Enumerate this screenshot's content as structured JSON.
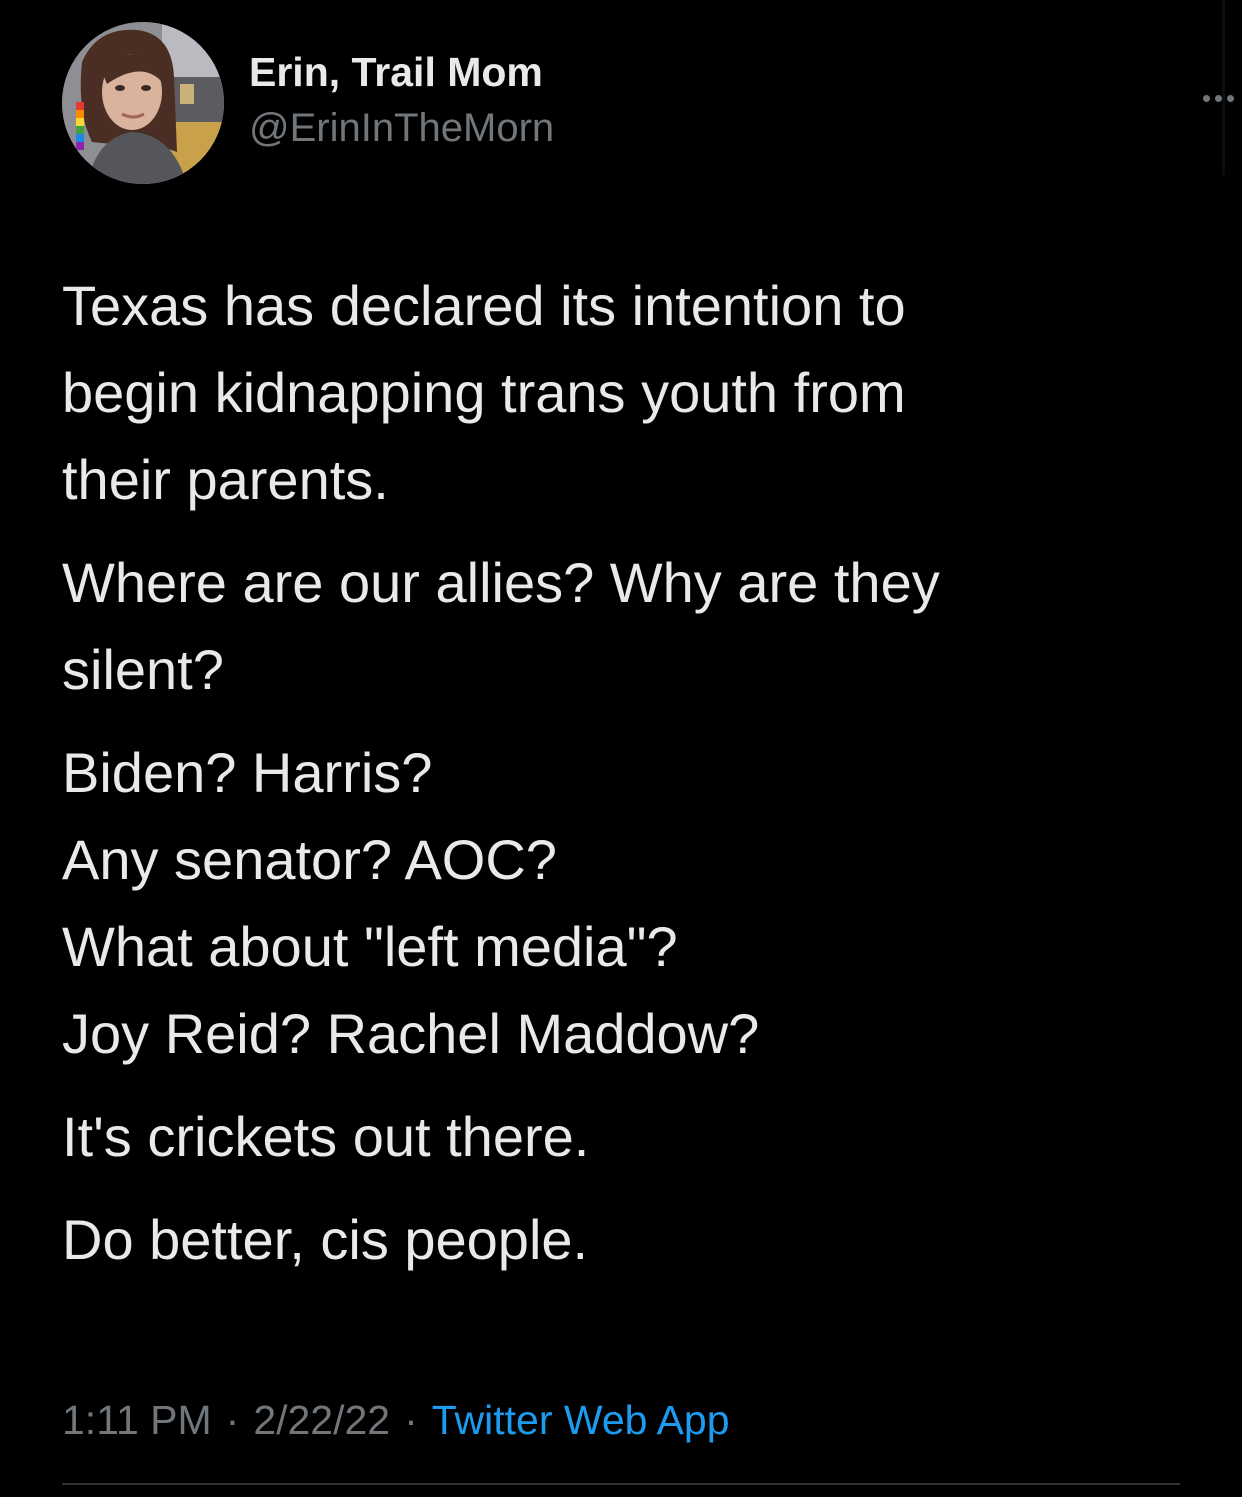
{
  "author": {
    "display_name": "Erin, Trail Mom",
    "handle": "@ErinInTheMorn"
  },
  "tweet": {
    "paragraphs": [
      [
        "Texas has declared its intention to",
        "begin kidnapping trans youth from",
        "their parents."
      ],
      [
        "Where are our allies? Why are they",
        "silent?"
      ],
      [
        "Biden? Harris?",
        "Any senator? AOC?",
        "What about \"left media\"?",
        "Joy Reid? Rachel Maddow?"
      ],
      [
        "It's crickets out there."
      ],
      [
        "Do better, cis people."
      ]
    ]
  },
  "meta": {
    "time": "1:11 PM",
    "separator": "·",
    "date": "2/22/22",
    "source": "Twitter Web App"
  },
  "icons": {
    "more": "more-horizontal-icon"
  },
  "colors": {
    "background": "#000000",
    "text": "#e7e9ea",
    "secondary_text": "#71767b",
    "link": "#1d9bf0"
  }
}
